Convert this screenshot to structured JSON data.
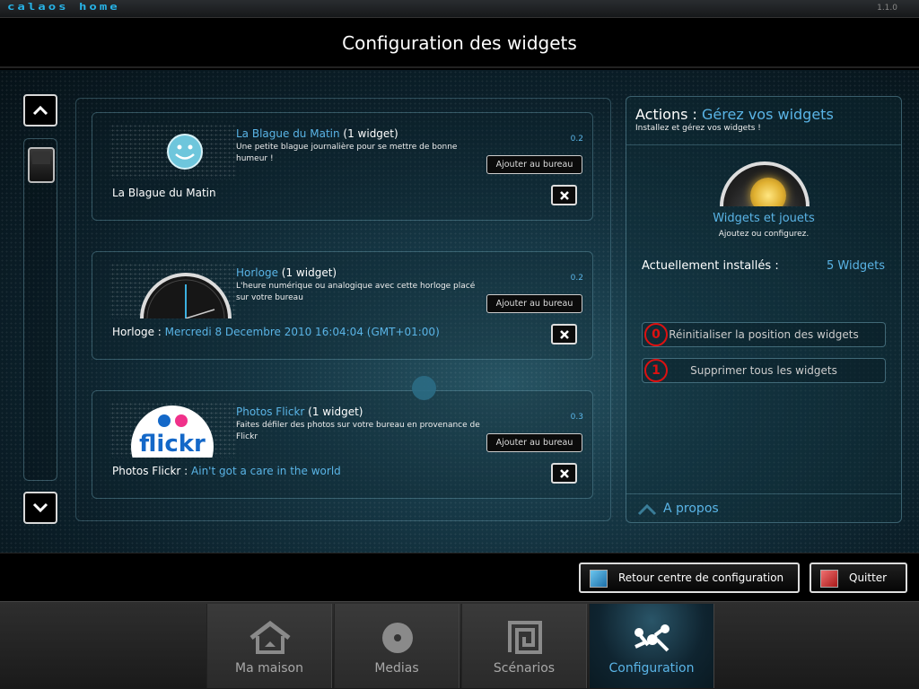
{
  "app": {
    "logo": "calaos home",
    "version": "1.1.0"
  },
  "header": {
    "title": "Configuration des widgets"
  },
  "widgets": [
    {
      "name": "La Blague du Matin",
      "count_text": " (1 widget)",
      "description": "Une petite blague journalière pour se mettre de bonne humeur !",
      "version": "0.2",
      "add_label": "Ajouter au bureau",
      "instance_label": "La Blague du Matin",
      "instance_value": "",
      "icon": "smiley-icon"
    },
    {
      "name": "Horloge",
      "count_text": " (1 widget)",
      "description": "L'heure numérique ou analogique avec cette horloge placé sur votre bureau",
      "version": "0.2",
      "add_label": "Ajouter au bureau",
      "instance_label": "Horloge : ",
      "instance_value": "Mercredi 8 Decembre 2010 16:04:04 (GMT+01:00)",
      "icon": "clock-icon"
    },
    {
      "name": "Photos Flickr",
      "count_text": " (1 widget)",
      "description": "Faites défiler des photos sur votre bureau en provenance de Flickr",
      "version": "0.3",
      "add_label": "Ajouter au bureau",
      "instance_label": "Photos Flickr : ",
      "instance_value": "Ain't got a care in the world",
      "icon": "flickr-logo",
      "logo_text": "flickr"
    }
  ],
  "actions": {
    "title_prefix": "Actions : ",
    "title_link": "Gérez vos widgets",
    "subtitle": "Installez et gérez vos widgets !",
    "widgets_link": "Widgets et jouets",
    "widgets_sub": "Ajoutez ou configurez.",
    "installed_label": "Actuellement installés :",
    "installed_count": "5 Widgets",
    "reset_number": "0",
    "reset_label": "Réinitialiser la position des widgets",
    "delete_number": "1",
    "delete_label": "Supprimer tous les widgets",
    "about_label": "A propos"
  },
  "buttons": {
    "back": "Retour centre de configuration",
    "quit": "Quitter"
  },
  "nav": [
    {
      "label": "Ma maison",
      "icon": "house-icon"
    },
    {
      "label": "Medias",
      "icon": "disc-icon"
    },
    {
      "label": "Scénarios",
      "icon": "scenario-icon"
    },
    {
      "label": "Configuration",
      "icon": "config-icon"
    }
  ],
  "colors": {
    "accent": "#5ab4e6",
    "brand": "#27b4e8",
    "danger": "#dd1111"
  }
}
